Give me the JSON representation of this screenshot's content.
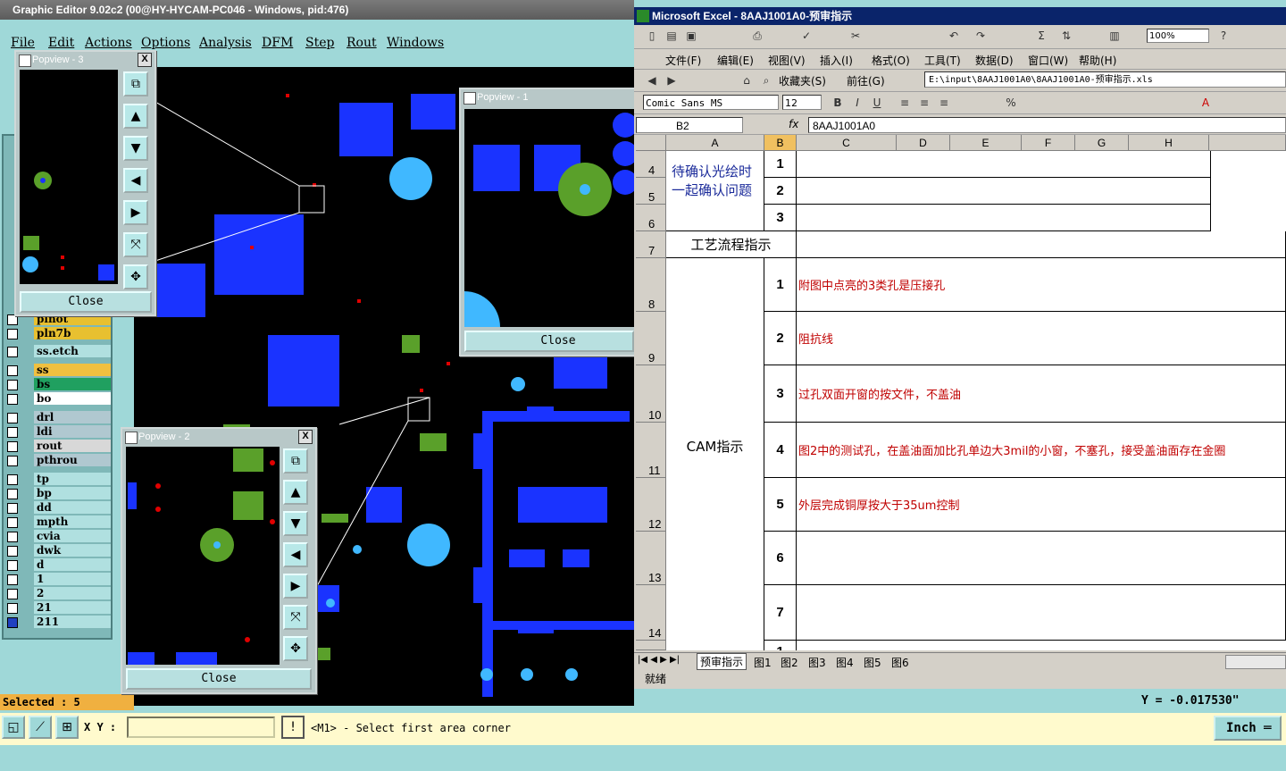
{
  "graphic_editor": {
    "title": "Graphic Editor 9.02c2 (00@HY-HYCAM-PC046 - Windows, pid:476)",
    "menus": [
      "File",
      "Edit",
      "Actions",
      "Options",
      "Analysis",
      "DFM",
      "Step",
      "Rout",
      "Windows"
    ],
    "layers": [
      "plnot",
      "pln7b",
      "ss.etch",
      "ss",
      "bs",
      "bo",
      "drl",
      "ldi",
      "rout",
      "pthrou",
      "tp",
      "bp",
      "dd",
      "mpth",
      "cvia",
      "dwk",
      "d",
      "1",
      "2",
      "21",
      "211"
    ],
    "selected_text": "Selected : 5",
    "coord_y": "Y = -0.017530\"",
    "xy_label": "X Y :",
    "prompt": "<M1> - Select first area corner",
    "unit": "Inch",
    "colors": {
      "panel": "#9fd8d8",
      "canvas": "#000000",
      "blue": "#1a33ff",
      "green": "#5aa02a",
      "cyan": "#40b8ff",
      "red": "#e00000"
    }
  },
  "popviews": [
    {
      "title": "Popview - 3",
      "close_label": "Close"
    },
    {
      "title": "Popview - 1",
      "close_label": "Close"
    },
    {
      "title": "Popview - 2",
      "close_label": "Close"
    }
  ],
  "excel": {
    "title": "Microsoft Excel - 8AAJ1001A0-预审指示",
    "menus": [
      "文件(F)",
      "编辑(E)",
      "视图(V)",
      "插入(I)",
      "格式(O)",
      "工具(T)",
      "数据(D)",
      "窗口(W)",
      "帮助(H)"
    ],
    "favorites": "收藏夹(S)",
    "goto": "前往(G)",
    "address": "E:\\input\\8AAJ1001A0\\8AAJ1001A0-预审指示.xls",
    "font_name": "Comic Sans MS",
    "font_size": "12",
    "zoom": "100%",
    "name_box": "B2",
    "formula": "8AAJ1001A0",
    "columns": [
      "A",
      "B",
      "C",
      "D",
      "E",
      "F",
      "G",
      "H"
    ],
    "row_numbers": [
      "4",
      "5",
      "6",
      "7",
      "8",
      "9",
      "10",
      "11",
      "12",
      "13",
      "14"
    ],
    "confirm_label": "待确认光绘时一起确认问题",
    "confirm_items": [
      "1",
      "2",
      "3"
    ],
    "process_label": "工艺流程指示",
    "cam_label": "CAM指示",
    "cam_items": [
      {
        "num": "1",
        "text": "附图中点亮的3类孔是压接孔"
      },
      {
        "num": "2",
        "text": "阻抗线"
      },
      {
        "num": "3",
        "text": "过孔双面开窗的按文件，不盖油"
      },
      {
        "num": "4",
        "text": "图2中的测试孔，在盖油面加比孔单边大3mil的小窗，不塞孔，接受盖油面存在金圈"
      },
      {
        "num": "5",
        "text": "外层完成铜厚按大于35um控制"
      },
      {
        "num": "6",
        "text": ""
      },
      {
        "num": "7",
        "text": ""
      }
    ],
    "partial_row": "1",
    "sheet_tabs": [
      "预审指示",
      "图1",
      "图2",
      "图3",
      "图4",
      "图5",
      "图6"
    ],
    "status": "就绪"
  }
}
